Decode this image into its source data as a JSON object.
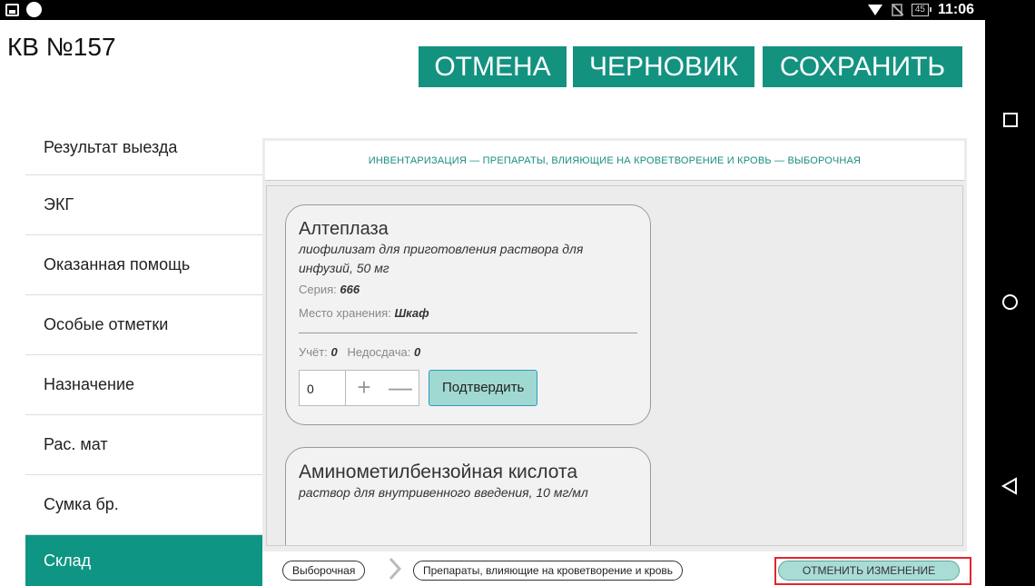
{
  "status_bar": {
    "battery": "45",
    "time": "11:06",
    "icons": [
      "picture-icon",
      "circle-icon",
      "wifi-icon",
      "no-sim-icon",
      "battery-icon"
    ]
  },
  "app": {
    "title": "КВ №157",
    "buttons": {
      "cancel": "ОТМЕНА",
      "draft": "ЧЕРНОВИК",
      "save": "СОХРАНИТЬ"
    },
    "accent_color": "#139280"
  },
  "sidebar": {
    "items": [
      {
        "label": "Результат выезда",
        "active": false
      },
      {
        "label": "ЭКГ",
        "active": false
      },
      {
        "label": "Оказанная помощь",
        "active": false
      },
      {
        "label": "Особые отметки",
        "active": false
      },
      {
        "label": "Назначение",
        "active": false
      },
      {
        "label": "Рас. мат",
        "active": false
      },
      {
        "label": "Сумка бр.",
        "active": false
      },
      {
        "label": "Склад",
        "active": true
      }
    ]
  },
  "main": {
    "header": "ИНВЕНТАРИЗАЦИЯ — ПРЕПАРАТЫ, ВЛИЯЮЩИЕ НА КРОВЕТВОРЕНИЕ И КРОВЬ — ВЫБОРОЧНАЯ",
    "cards": [
      {
        "name": "Алтеплаза",
        "desc": "лиофилизат для приготовления раствора для инфузий, 50 мг",
        "series_label": "Серия:",
        "series_value": "666",
        "storage_label": "Место хранения:",
        "storage_value": "Шкаф",
        "account_label": "Учёт:",
        "account_value": "0",
        "shortage_label": "Недосдача:",
        "shortage_value": "0",
        "qty_value": "0",
        "plus": "+",
        "minus": "—",
        "confirm": "Подтвердить"
      },
      {
        "name": "Аминометилбензойная кислота",
        "desc": "раствор для внутривенного введения, 10 мг/мл"
      }
    ],
    "breadcrumb": {
      "first": "Выборочная",
      "second": "Препараты, влияющие на кроветворение и кровь"
    },
    "revert_button": "ОТМЕНИТЬ ИЗМЕНЕНИЕ",
    "highlight_color": "#e0262f"
  },
  "navbar": {
    "icons": [
      "recents-icon",
      "home-icon",
      "back-icon"
    ]
  }
}
